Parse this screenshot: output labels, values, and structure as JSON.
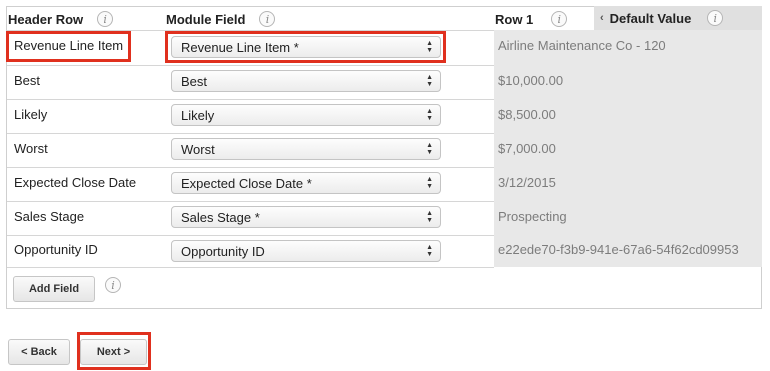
{
  "headers": {
    "header_row": "Header Row",
    "module_field": "Module Field",
    "row1": "Row 1",
    "default_value": "Default Value",
    "info_glyph": "i"
  },
  "rows": [
    {
      "label": "Revenue Line Item",
      "field": "Revenue Line Item *",
      "preview": "Airline Maintenance Co - 120"
    },
    {
      "label": "Best",
      "field": "Best",
      "preview": "$10,000.00"
    },
    {
      "label": "Likely",
      "field": "Likely",
      "preview": "$8,500.00"
    },
    {
      "label": "Worst",
      "field": "Worst",
      "preview": "$7,000.00"
    },
    {
      "label": "Expected Close Date",
      "field": "Expected Close Date *",
      "preview": "3/12/2015"
    },
    {
      "label": "Sales Stage",
      "field": "Sales Stage *",
      "preview": "Prospecting"
    },
    {
      "label": "Opportunity ID",
      "field": "Opportunity ID",
      "preview": "e22ede70-f3b9-941e-67a6-54f62cd09953"
    }
  ],
  "buttons": {
    "add_field": "Add Field",
    "back": "< Back",
    "next": "Next >"
  },
  "icons": {
    "info": "info-circle-icon",
    "collapse": "chevron-left-icon",
    "select_arrows": "up-down-arrows-icon"
  },
  "colors": {
    "highlight": "#e0301e",
    "preview_column": "#e8e8e8"
  }
}
